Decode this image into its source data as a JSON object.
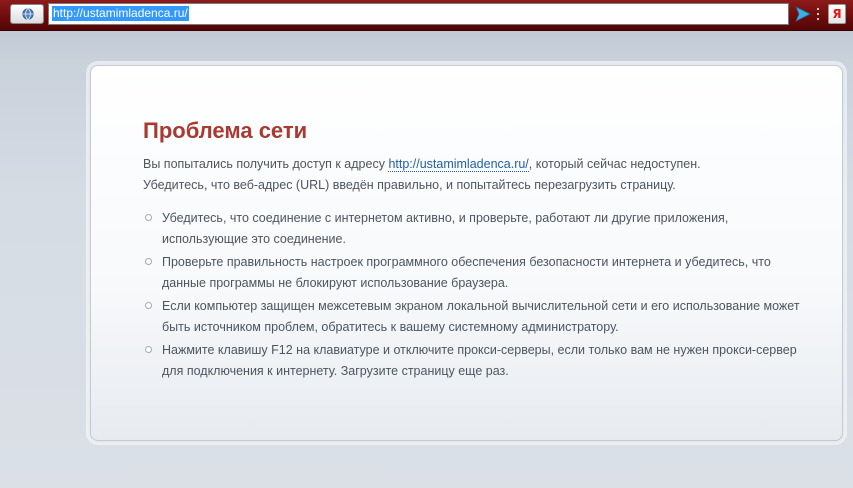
{
  "toolbar": {
    "address_url": "http://ustamimladenca.ru/",
    "yandex_label": "Я"
  },
  "error_page": {
    "title": "Проблема сети",
    "intro_before": "Вы попытались получить доступ к адресу ",
    "intro_link": "http://ustamimladenca.ru/",
    "intro_after": ", который сейчас недоступен.",
    "intro_line2": "Убедитесь, что веб-адрес (URL) введён правильно, и попытайтесь перезагрузить страницу.",
    "tips": [
      "Убедитесь, что соединение с интернетом активно, и проверьте, работают ли другие приложения, использующие это соединение.",
      "Проверьте правильность настроек программного обеспечения безопасности интернета и убедитесь, что данные программы не блокируют использование браузера.",
      "Если компьютер защищен межсетевым экраном локальной вычислительной сети и его использование может быть источником проблем, обратитесь к вашему системному администратору.",
      "Нажмите клавишу F12 на клавиатуре и отключите прокси-серверы, если только вам не нужен прокси-сервер для подключения к интернету. Загрузите страницу еще раз."
    ]
  },
  "colors": {
    "toolbar_bg": "#6e0c0c",
    "title": "#a83a32",
    "link": "#1f5fa8",
    "body_text": "#4d5560",
    "selection": "#3399ff"
  },
  "icons": {
    "site_info": "globe-icon",
    "go": "go-arrow-icon",
    "menu": "menu-dots-icon",
    "yandex": "yandex-icon"
  }
}
